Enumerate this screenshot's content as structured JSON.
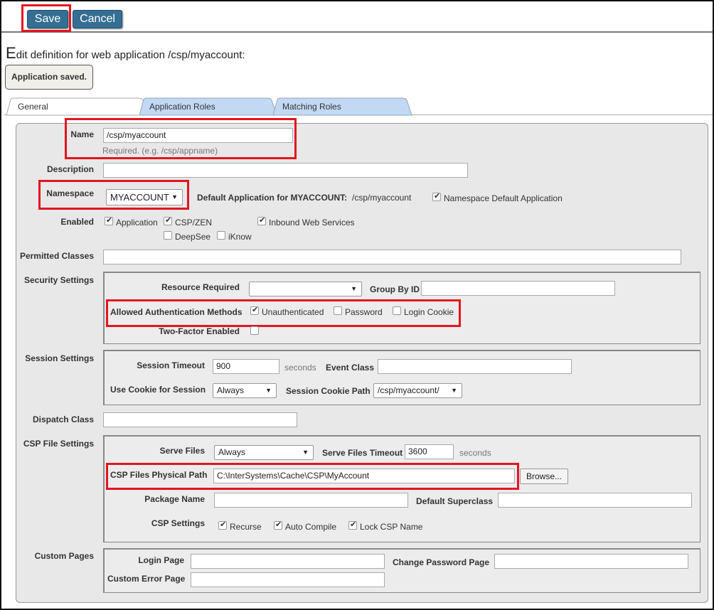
{
  "toolbar": {
    "save_label": "Save",
    "cancel_label": "Cancel"
  },
  "page": {
    "title_first": "E",
    "title_rest": "dit definition for web application /csp/myaccount:",
    "status_message": "Application saved."
  },
  "tabs": [
    {
      "label": "General",
      "active": true
    },
    {
      "label": "Application Roles",
      "active": false
    },
    {
      "label": "Matching Roles",
      "active": false
    }
  ],
  "general": {
    "name": {
      "label": "Name",
      "value": "/csp/myaccount",
      "hint": "Required. (e.g. /csp/appname)"
    },
    "description": {
      "label": "Description",
      "value": ""
    },
    "namespace": {
      "label": "Namespace",
      "value": "MYACCOUNT",
      "default_app_label": "Default Application for MYACCOUNT:",
      "default_app_value": "/csp/myaccount",
      "ns_default_label": "Namespace Default Application",
      "ns_default_checked": true
    },
    "enabled": {
      "label": "Enabled",
      "options": [
        {
          "label": "Application",
          "checked": true
        },
        {
          "label": "CSP/ZEN",
          "checked": true
        },
        {
          "label": "Inbound Web Services",
          "checked": true
        },
        {
          "label": "DeepSee",
          "checked": false
        },
        {
          "label": "iKnow",
          "checked": false
        }
      ]
    },
    "permitted_classes": {
      "label": "Permitted Classes",
      "value": ""
    }
  },
  "security": {
    "section_label": "Security Settings",
    "resource_required": {
      "label": "Resource Required",
      "value": ""
    },
    "group_by_id": {
      "label": "Group By ID",
      "value": ""
    },
    "auth_methods": {
      "label": "Allowed Authentication Methods",
      "options": [
        {
          "label": "Unauthenticated",
          "checked": true
        },
        {
          "label": "Password",
          "checked": false
        },
        {
          "label": "Login Cookie",
          "checked": false
        }
      ]
    },
    "two_factor": {
      "label": "Two-Factor Enabled",
      "checked": false
    }
  },
  "session": {
    "section_label": "Session Settings",
    "timeout": {
      "label": "Session Timeout",
      "value": "900",
      "unit": "seconds"
    },
    "event_class": {
      "label": "Event Class",
      "value": ""
    },
    "use_cookie": {
      "label": "Use Cookie for Session",
      "value": "Always"
    },
    "cookie_path": {
      "label": "Session Cookie Path",
      "value": "/csp/myaccount/"
    }
  },
  "dispatch": {
    "label": "Dispatch Class",
    "value": ""
  },
  "csp_files": {
    "section_label": "CSP File Settings",
    "serve_files": {
      "label": "Serve Files",
      "value": "Always"
    },
    "serve_timeout": {
      "label": "Serve Files Timeout",
      "value": "3600",
      "unit": "seconds"
    },
    "physical_path": {
      "label": "CSP Files Physical Path",
      "value": "C:\\InterSystems\\Cache\\CSP\\MyAccount",
      "browse_label": "Browse..."
    },
    "package_name": {
      "label": "Package Name",
      "value": ""
    },
    "default_superclass": {
      "label": "Default Superclass",
      "value": ""
    },
    "csp_settings": {
      "label": "CSP Settings",
      "options": [
        {
          "label": "Recurse",
          "checked": true
        },
        {
          "label": "Auto Compile",
          "checked": true
        },
        {
          "label": "Lock CSP Name",
          "checked": true
        }
      ]
    }
  },
  "custom_pages": {
    "section_label": "Custom Pages",
    "login_page": {
      "label": "Login Page",
      "value": ""
    },
    "change_password_page": {
      "label": "Change Password Page",
      "value": ""
    },
    "custom_error_page": {
      "label": "Custom Error Page",
      "value": ""
    }
  },
  "colors": {
    "button_blue": "#356e93",
    "highlight_red": "#e3141f",
    "tab_inactive": "#c3d9f3",
    "panel_bg": "#e8e8e8"
  }
}
